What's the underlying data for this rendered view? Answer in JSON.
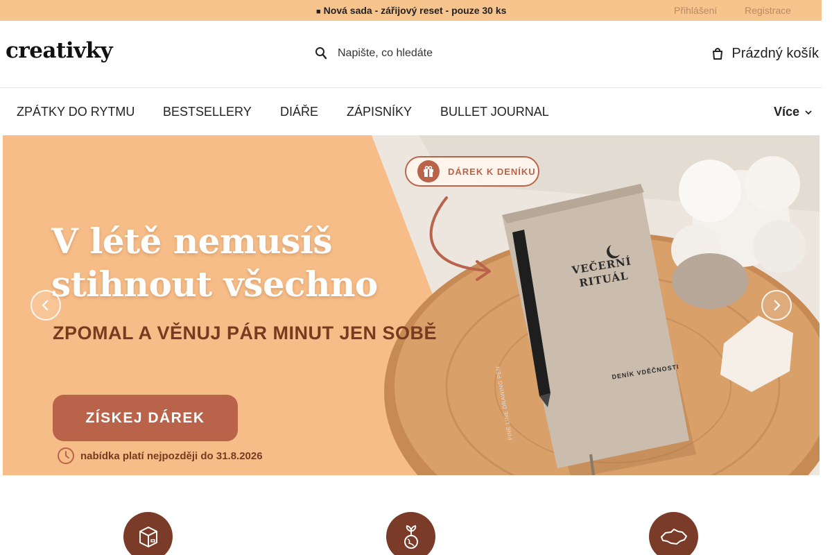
{
  "topbar": {
    "promo_icon": "truck-icon",
    "promo_text": "Nová sada - zářijový reset - pouze 30 ks",
    "login_label": "Přihlášení",
    "register_label": "Registrace"
  },
  "header": {
    "logo_text": "creativky",
    "search_placeholder": "Napište, co hledáte",
    "search_icon": "search-icon",
    "cart_icon": "cart-icon",
    "cart_label": "Prázdný košík"
  },
  "nav": {
    "items": [
      {
        "label": "ZPÁTKY DO RYTMU"
      },
      {
        "label": "BESTSELLERY"
      },
      {
        "label": "DIÁŘE"
      },
      {
        "label": "ZÁPISNÍKY"
      },
      {
        "label": "BULLET JOURNAL"
      }
    ],
    "more_label": "Více"
  },
  "banner": {
    "gift_pill_label": "DÁREK K DENÍKU",
    "headline_line1": "V létě nemusíš",
    "headline_line2": "stihnout všechno",
    "subline": "ZPOMAL A VĚNUJ PÁR MINUT JEN SOBĚ",
    "cta_label": "ZÍSKEJ DÁREK",
    "note": "nabídka platí nejpozději do 31.8.2026",
    "book_title_line1": "VEČERNÍ",
    "book_title_line2": "RITUÁL",
    "book_subtitle": "DENÍK VDĚČNOSTI",
    "pen_text": "FINE LINE DRAWING PEN",
    "colors": {
      "peach": "#f6bd88",
      "terracotta": "#b9634a",
      "brown": "#7a3a1f"
    }
  },
  "features": [
    {
      "icon": "box-icon"
    },
    {
      "icon": "plant-globe-icon"
    },
    {
      "icon": "czech-map-icon"
    }
  ],
  "colors": {
    "topbar_bg": "#f8c48e",
    "feature_circle": "#7a3b28"
  }
}
